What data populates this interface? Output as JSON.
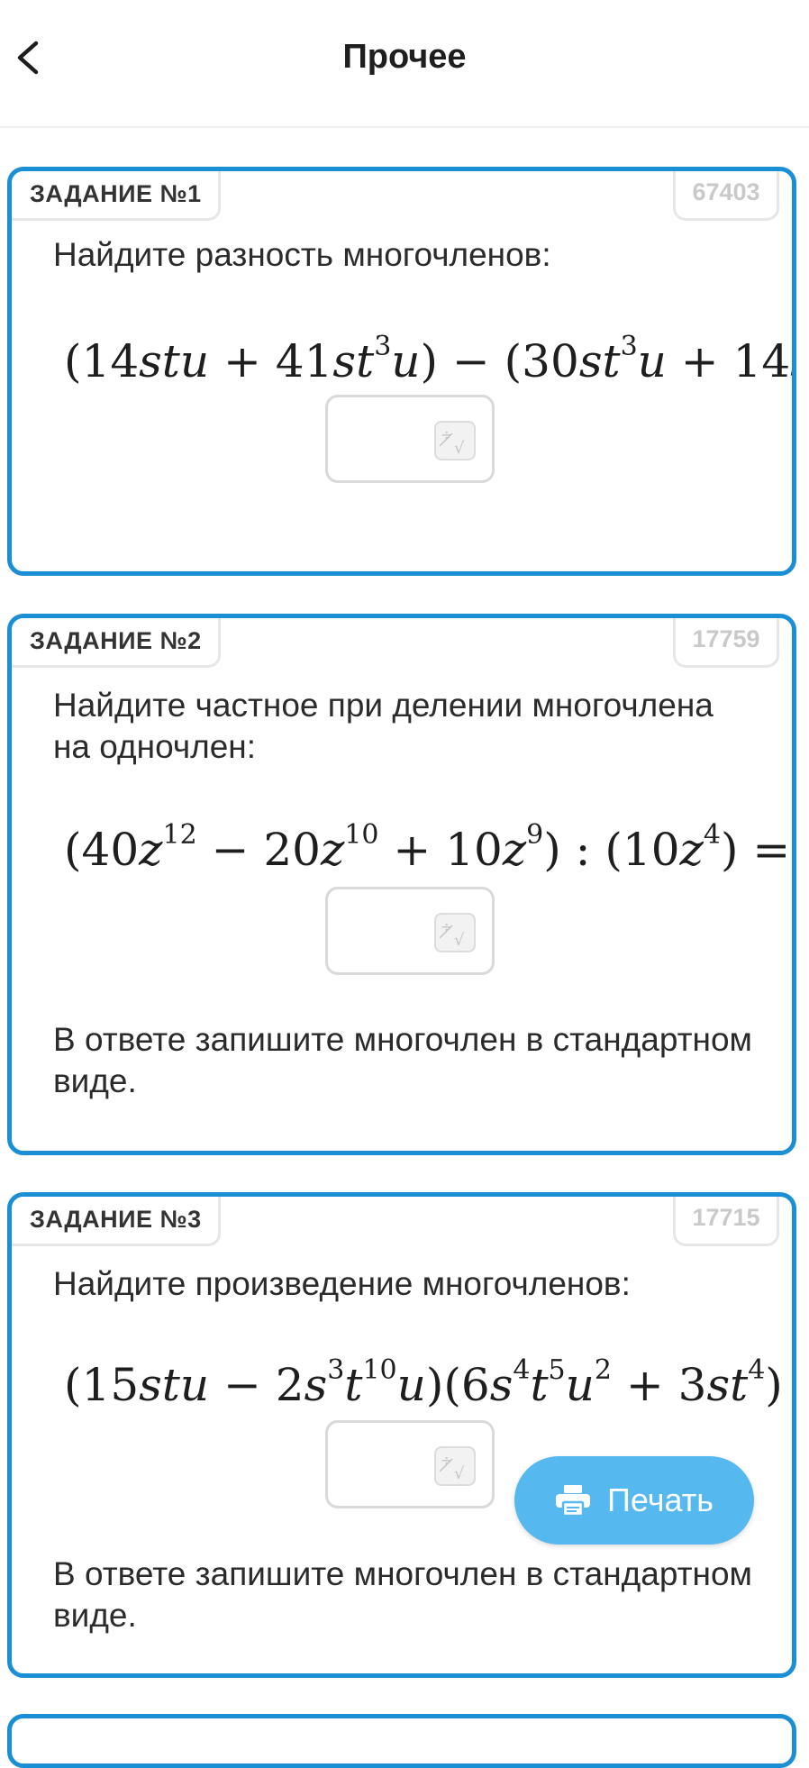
{
  "header": {
    "title": "Прочее",
    "back_icon": "chevron-left-icon"
  },
  "tasks": [
    {
      "label": "ЗАДАНИЕ №1",
      "id": "67403",
      "question": "Найдите разность многочленов:",
      "answer_value": "",
      "note": ""
    },
    {
      "label": "ЗАДАНИЕ №2",
      "id": "17759",
      "question": "Найдите частное при делении многочлена на одночлен:",
      "answer_value": "",
      "note": "В ответе запишите многочлен в стандартном виде."
    },
    {
      "label": "ЗАДАНИЕ №3",
      "id": "17715",
      "question": "Найдите произведение многочленов:",
      "answer_value": "",
      "note": "В ответе запишите многочлен в стандартном виде."
    }
  ],
  "print_button": {
    "label": "Печать",
    "icon": "printer-icon"
  },
  "colors": {
    "accent": "#1b8fd6",
    "print_button": "#55b8ef",
    "muted": "#c9c9c9"
  }
}
